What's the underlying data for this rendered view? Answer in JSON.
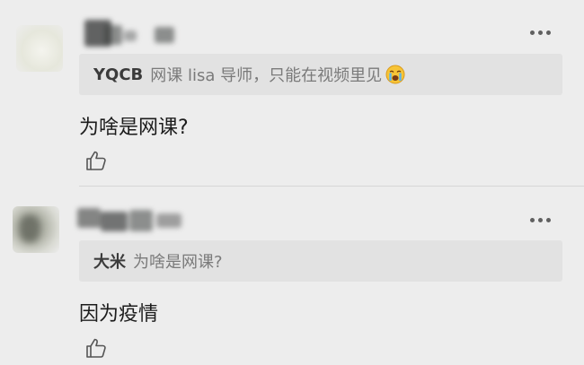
{
  "comments": [
    {
      "quote_user": "YQCB",
      "quote_text": "网课 lisa 导师，只能在视频里见",
      "quote_emoji_icon": "crying-face-icon",
      "text": "为啥是网课?",
      "like_icon": "thumbs-up-icon",
      "more_icon": "more-dots-icon"
    },
    {
      "quote_user": "大米",
      "quote_text": "为啥是网课?",
      "text": "因为疫情",
      "like_icon": "thumbs-up-icon",
      "more_icon": "more-dots-icon"
    }
  ],
  "colors": {
    "background": "#ededed",
    "quote_background": "#e2e2e2",
    "quote_user": "#3b3b3b",
    "quote_text": "#7a7a7a",
    "body_text": "#1c1c1c",
    "divider": "#d6d6d6"
  }
}
